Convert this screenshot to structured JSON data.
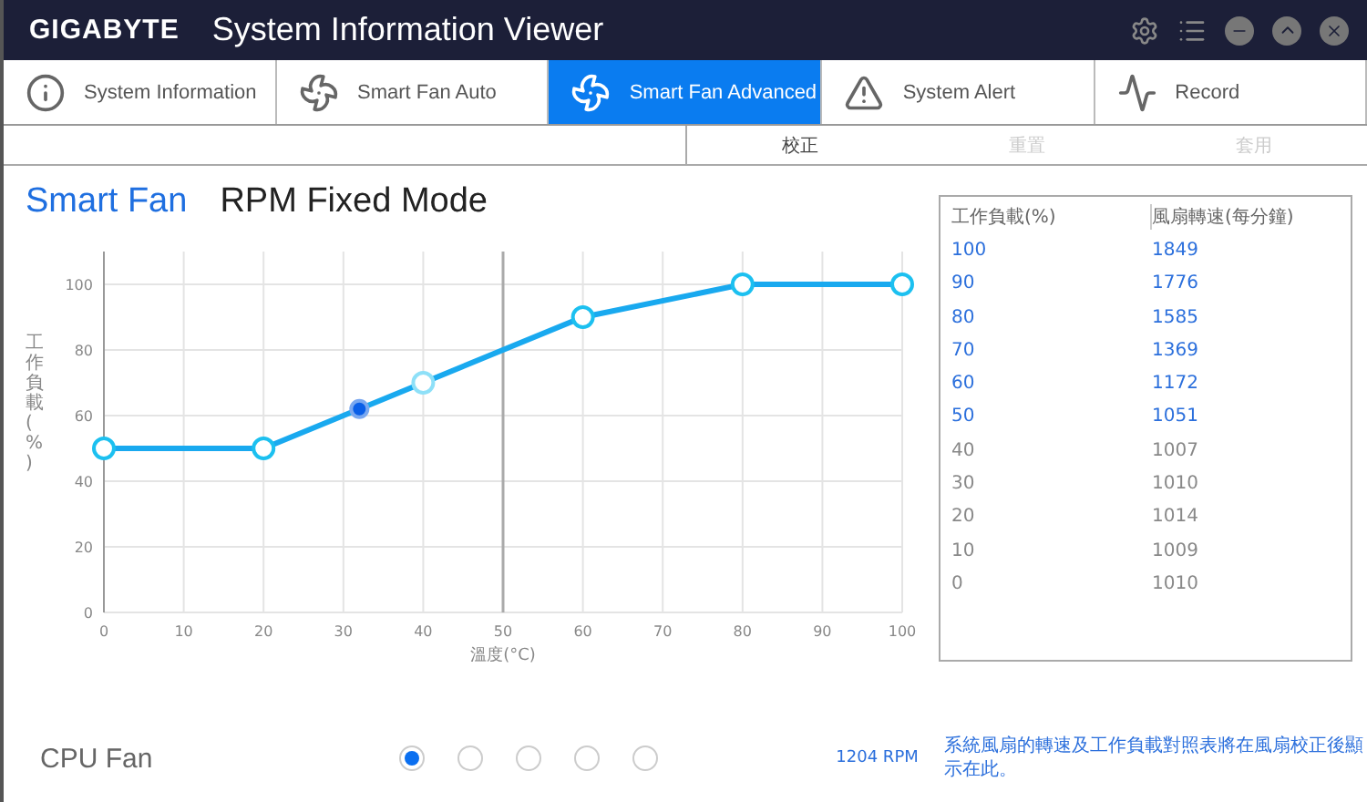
{
  "window": {
    "brand": "GIGABYTE",
    "title": "System Information Viewer"
  },
  "tabs": [
    {
      "label": "System Information",
      "selected": false
    },
    {
      "label": "Smart Fan Auto",
      "selected": false
    },
    {
      "label": "Smart Fan Advanced",
      "selected": true
    },
    {
      "label": "System Alert",
      "selected": false
    },
    {
      "label": "Record",
      "selected": false
    }
  ],
  "actions": [
    {
      "label": "校正",
      "disabled": false
    },
    {
      "label": "重置",
      "disabled": true
    },
    {
      "label": "套用",
      "disabled": true
    }
  ],
  "modes": [
    {
      "label": "Smart Fan",
      "selected": true
    },
    {
      "label": "RPM Fixed Mode",
      "selected": false
    }
  ],
  "chart": {
    "ylabel_vertical": "工作負載(%)",
    "chart_data": {
      "type": "line",
      "xlabel": "溫度(°C)",
      "x": [
        0,
        20,
        40,
        60,
        80,
        100
      ],
      "series": [
        {
          "color": "#19a9ef",
          "marker": "o",
          "values": [
            50,
            50,
            70,
            90,
            100,
            100
          ]
        }
      ],
      "xlim": [
        0,
        100
      ],
      "ylim": [
        0,
        110
      ],
      "xticks": [
        0,
        10,
        20,
        30,
        40,
        50,
        60,
        70,
        80,
        90,
        100
      ],
      "yticks": [
        0,
        20,
        40,
        60,
        80,
        100
      ],
      "grid": true,
      "ref_lines": [
        {
          "axis": "x",
          "value": 50
        }
      ]
    }
  },
  "table": {
    "columns": [
      "工作負載(%)",
      "風扇轉速(每分鐘)"
    ],
    "rows": [
      {
        "cells": [
          "100",
          "1849"
        ],
        "highlighted": true
      },
      {
        "cells": [
          "90",
          "1776"
        ],
        "highlighted": true
      },
      {
        "cells": [
          "80",
          "1585"
        ],
        "highlighted": true
      },
      {
        "cells": [
          "70",
          "1369"
        ],
        "highlighted": true
      },
      {
        "cells": [
          "60",
          "1172"
        ],
        "highlighted": true
      },
      {
        "cells": [
          "50",
          "1051"
        ],
        "highlighted": true
      },
      {
        "cells": [
          "40",
          "1007"
        ],
        "highlighted": false
      },
      {
        "cells": [
          "30",
          "1010"
        ],
        "highlighted": false
      },
      {
        "cells": [
          "20",
          "1014"
        ],
        "highlighted": false
      },
      {
        "cells": [
          "10",
          "1009"
        ],
        "highlighted": false
      },
      {
        "cells": [
          "0",
          "1010"
        ],
        "highlighted": false
      }
    ]
  },
  "fan": {
    "name": "CPU Fan",
    "profiles": [
      {
        "selected": true
      },
      {
        "selected": false
      },
      {
        "selected": false
      },
      {
        "selected": false
      },
      {
        "selected": false
      }
    ],
    "reading": "1204 RPM"
  },
  "note": "系統風扇的轉速及工作負載對照表將在風扇校正後顯示在此。"
}
